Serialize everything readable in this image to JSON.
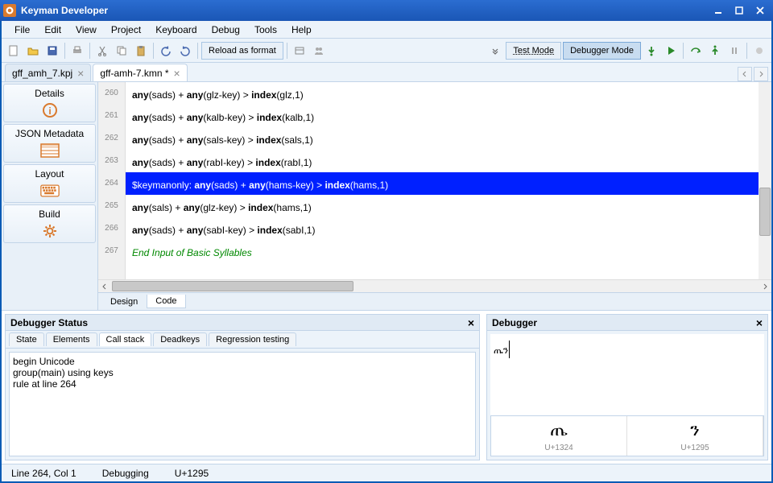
{
  "app": {
    "title": "Keyman Developer"
  },
  "menu": [
    "File",
    "Edit",
    "View",
    "Project",
    "Keyboard",
    "Debug",
    "Tools",
    "Help"
  ],
  "toolbar": {
    "reload_label": "Reload as format",
    "test_mode": "Test Mode",
    "debugger_mode": "Debugger Mode"
  },
  "tabs": [
    {
      "label": "gff_amh_7.kpj",
      "active": false
    },
    {
      "label": "gff-amh-7.kmn *",
      "active": true
    }
  ],
  "sidebar": [
    {
      "id": "details",
      "label": "Details"
    },
    {
      "id": "json-metadata",
      "label": "JSON Metadata"
    },
    {
      "id": "layout",
      "label": "Layout"
    },
    {
      "id": "build",
      "label": "Build"
    }
  ],
  "code": {
    "first_line": 260,
    "lines": [
      {
        "seg": [
          [
            "    ",
            ""
          ],
          [
            "any",
            "kw"
          ],
          [
            "(sads) + ",
            ""
          ],
          [
            "any",
            "kw"
          ],
          [
            "(glz-key)  > ",
            ""
          ],
          [
            "index",
            "kw"
          ],
          [
            "(glz,1)",
            ""
          ]
        ]
      },
      {
        "seg": [
          [
            "    ",
            ""
          ],
          [
            "any",
            "kw"
          ],
          [
            "(sads) + ",
            ""
          ],
          [
            "any",
            "kw"
          ],
          [
            "(kalb-key) > ",
            ""
          ],
          [
            "index",
            "kw"
          ],
          [
            "(kalb,1)",
            ""
          ]
        ]
      },
      {
        "seg": [
          [
            "    ",
            ""
          ],
          [
            "any",
            "kw"
          ],
          [
            "(sads) + ",
            ""
          ],
          [
            "any",
            "kw"
          ],
          [
            "(sals-key) > ",
            ""
          ],
          [
            "index",
            "kw"
          ],
          [
            "(sals,1)",
            ""
          ]
        ]
      },
      {
        "seg": [
          [
            "    ",
            ""
          ],
          [
            "any",
            "kw"
          ],
          [
            "(sads) + ",
            ""
          ],
          [
            "any",
            "kw"
          ],
          [
            "(rabI-key) > ",
            ""
          ],
          [
            "index",
            "kw"
          ],
          [
            "(rabI,1)",
            ""
          ]
        ]
      },
      {
        "hl": true,
        "seg": [
          [
            "$keymanonly: ",
            ""
          ],
          [
            "any",
            "kw"
          ],
          [
            "(sads) + ",
            ""
          ],
          [
            "any",
            "kw"
          ],
          [
            "(hams-key) > ",
            ""
          ],
          [
            "index",
            "kw"
          ],
          [
            "(hams,1)",
            ""
          ]
        ]
      },
      {
        "seg": [
          [
            "    ",
            ""
          ],
          [
            "any",
            "kw"
          ],
          [
            "(sals) + ",
            ""
          ],
          [
            "any",
            "kw"
          ],
          [
            "(glz-key)  > ",
            ""
          ],
          [
            "index",
            "kw"
          ],
          [
            "(hams,1)",
            ""
          ]
        ]
      },
      {
        "seg": [
          [
            "    ",
            ""
          ],
          [
            "any",
            "kw"
          ],
          [
            "(sads) + ",
            ""
          ],
          [
            "any",
            "kw"
          ],
          [
            "(sabI-key) > ",
            ""
          ],
          [
            "index",
            "kw"
          ],
          [
            "(sabI,1)",
            ""
          ]
        ]
      },
      {
        "seg": [
          [
            "                                         End Input of Basic Syllables",
            "comment"
          ]
        ]
      }
    ]
  },
  "bottom_tabs": [
    {
      "label": "Design",
      "active": false
    },
    {
      "label": "Code",
      "active": true
    }
  ],
  "debugger_status": {
    "title": "Debugger Status",
    "tabs": [
      "State",
      "Elements",
      "Call stack",
      "Deadkeys",
      "Regression testing"
    ],
    "active_tab": 2,
    "callstack": [
      "begin Unicode",
      "group(main) using keys",
      "rule at line 264"
    ]
  },
  "debugger": {
    "title": "Debugger",
    "output": "ጤን",
    "chars": [
      {
        "glyph": "ጤ",
        "code": "U+1324"
      },
      {
        "glyph": "ን",
        "code": "U+1295"
      }
    ]
  },
  "statusbar": {
    "pos": "Line 264, Col 1",
    "mode": "Debugging",
    "char": "U+1295"
  }
}
